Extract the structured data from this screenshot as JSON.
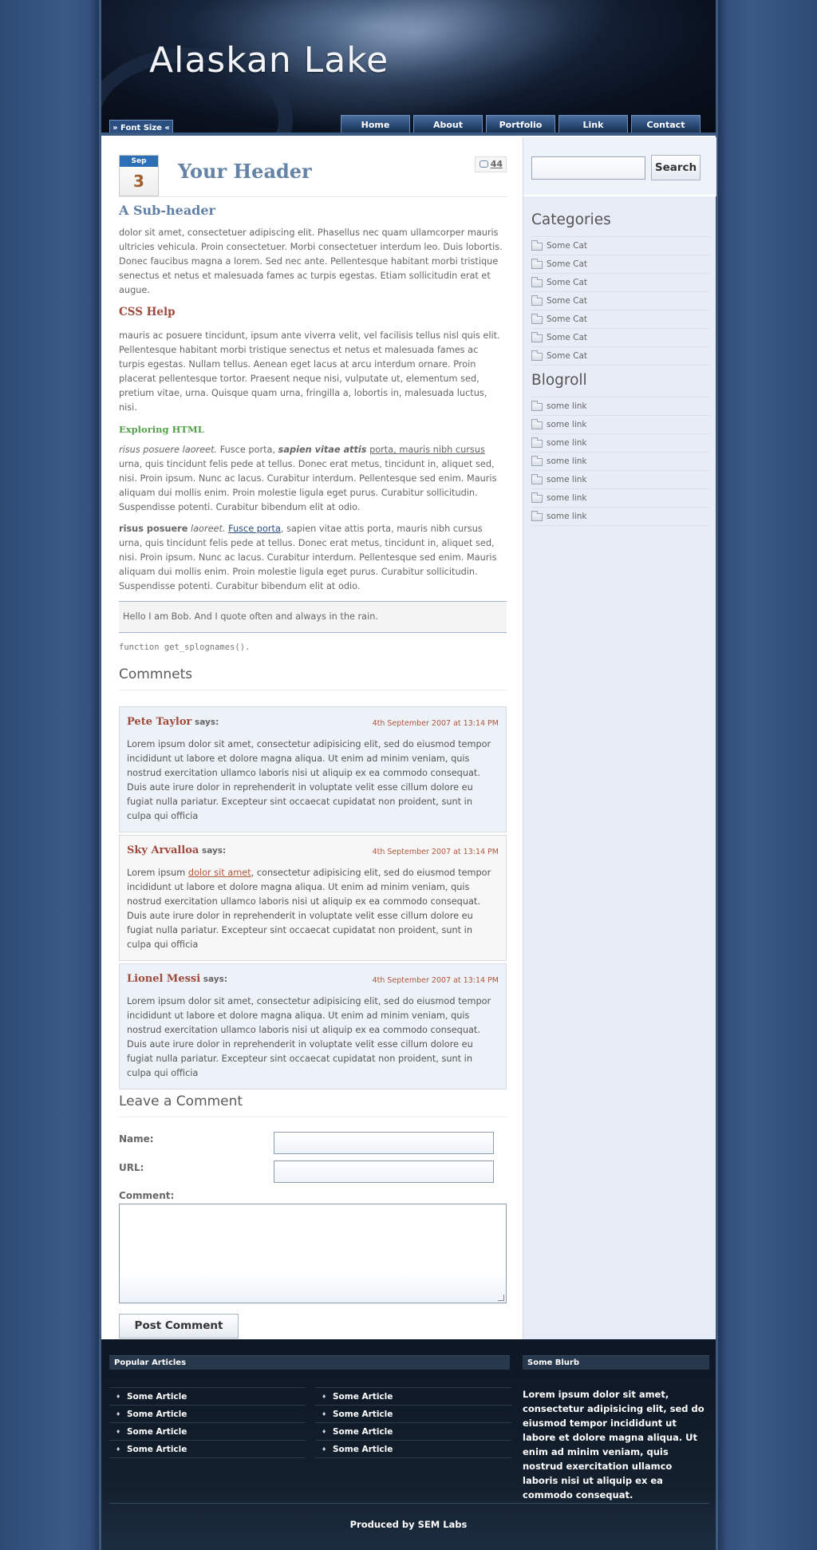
{
  "site": {
    "title": "Alaskan Lake",
    "font_size_label": "» Font Size «"
  },
  "nav": [
    "Home",
    "About",
    "Portfolio",
    "Link",
    "Contact"
  ],
  "post": {
    "month": "Sep",
    "day": "3",
    "comment_count": "44",
    "title": "Your Header",
    "subheader": "A Sub-header",
    "p1": "dolor sit amet, consectetuer adipiscing elit. Phasellus nec quam ullamcorper mauris ultricies vehicula. Proin consectetuer. Morbi consectetuer interdum leo. Duis lobortis. Donec faucibus magna a lorem. Sed nec ante. Pellentesque habitant morbi tristique senectus et netus et malesuada fames ac turpis egestas. Etiam sollicitudin erat et augue.",
    "css_help": "CSS Help",
    "p2": "mauris ac posuere tincidunt, ipsum ante viverra velit, vel facilisis tellus nisl quis elit. Pellentesque habitant morbi tristique senectus et netus et malesuada fames ac turpis egestas. Nullam tellus. Aenean eget lacus at arcu interdum ornare. Proin placerat pellentesque tortor. Praesent neque nisi, vulputate ut, elementum sed, pretium vitae, urna. Quisque quam urna, fringilla a, lobortis in, malesuada luctus, nisi.",
    "exploring": "Exploring HTML",
    "p3_italic": "risus posuere laoreet.",
    "p3_mid": " Fusce porta, ",
    "p3_bold_italic": "sapien vitae attis",
    "p3_sp": " ",
    "p3_link": "porta, mauris nibh cursus",
    "p3_rest": " urna, quis tincidunt felis pede at tellus. Donec erat metus, tincidunt in, aliquet sed, nisi. Proin ipsum. Nunc ac lacus. Curabitur interdum. Pellentesque sed enim. Mauris aliquam dui mollis enim. Proin molestie ligula eget purus. Curabitur sollicitudin. Suspendisse potenti. Curabitur bibendum elit at odio.",
    "p4_bold": "risus posuere",
    "p4_sp": " ",
    "p4_italic": "laoreet.",
    "p4_sp2": " ",
    "p4_link": "Fusce porta",
    "p4_rest": ", sapien vitae attis porta, mauris nibh cursus urna, quis tincidunt felis pede at tellus. Donec erat metus, tincidunt in, aliquet sed, nisi. Proin ipsum. Nunc ac lacus. Curabitur interdum. Pellentesque sed enim. Mauris aliquam dui mollis enim. Proin molestie ligula eget purus. Curabitur sollicitudin. Suspendisse potenti. Curabitur bibendum elit at odio.",
    "quote": "Hello I am Bob. And I quote often and always in the rain.",
    "code": "function get_splognames()."
  },
  "comments": {
    "heading": "Commnets",
    "says": "says:",
    "items": [
      {
        "author": "Pete Taylor",
        "time": "4th September 2007 at 13:14 PM",
        "text": "Lorem ipsum dolor sit amet, consectetur adipisicing elit, sed do eiusmod tempor incididunt ut labore et dolore magna aliqua. Ut enim ad minim veniam, quis nostrud exercitation ullamco laboris nisi ut aliquip ex ea commodo consequat. Duis aute irure dolor in reprehenderit in voluptate velit esse cillum dolore eu fugiat nulla pariatur. Excepteur sint occaecat cupidatat non proident, sunt in culpa qui officia"
      },
      {
        "author": "Sky Arvalloa",
        "time": "4th September 2007 at 13:14 PM",
        "text_pre": "Lorem ipsum ",
        "text_link": "dolor sit amet",
        "text_post": ", consectetur adipisicing elit, sed do eiusmod tempor incididunt ut labore et dolore magna aliqua. Ut enim ad minim veniam, quis nostrud exercitation ullamco laboris nisi ut aliquip ex ea commodo consequat. Duis aute irure dolor in reprehenderit in voluptate velit esse cillum dolore eu fugiat nulla pariatur. Excepteur sint occaecat cupidatat non proident, sunt in culpa qui officia"
      },
      {
        "author": "Lionel Messi",
        "time": "4th September 2007 at 13:14 PM",
        "text": "Lorem ipsum dolor sit amet, consectetur adipisicing elit, sed do eiusmod tempor incididunt ut labore et dolore magna aliqua. Ut enim ad minim veniam, quis nostrud exercitation ullamco laboris nisi ut aliquip ex ea commodo consequat. Duis aute irure dolor in reprehenderit in voluptate velit esse cillum dolore eu fugiat nulla pariatur. Excepteur sint occaecat cupidatat non proident, sunt in culpa qui officia"
      }
    ]
  },
  "form": {
    "heading": "Leave a Comment",
    "name_label": "Name:",
    "url_label": "URL:",
    "comment_label": "Comment:",
    "submit_label": "Post Comment"
  },
  "sidebar": {
    "search_button": "Search",
    "categories_heading": "Categories",
    "categories": [
      "Some Cat",
      "Some Cat",
      "Some Cat",
      "Some Cat",
      "Some Cat",
      "Some Cat",
      "Some Cat"
    ],
    "blogroll_heading": "Blogroll",
    "blogroll": [
      "some link",
      "some link",
      "some link",
      "some link",
      "some link",
      "some link",
      "some link"
    ]
  },
  "footer": {
    "popular_heading": "Popular Articles",
    "articles_left": [
      "Some Article",
      "Some Article",
      "Some Article",
      "Some Article"
    ],
    "articles_right": [
      "Some Article",
      "Some Article",
      "Some Article",
      "Some Article"
    ],
    "blurb_heading": "Some Blurb",
    "blurb": "Lorem ipsum dolor sit amet, consectetur adipisicing elit, sed do eiusmod tempor incididunt ut labore et dolore magna aliqua. Ut enim ad minim veniam, quis nostrud exercitation ullamco laboris nisi ut aliquip ex ea commodo consequat.",
    "credit": "Produced by SEM Labs"
  }
}
